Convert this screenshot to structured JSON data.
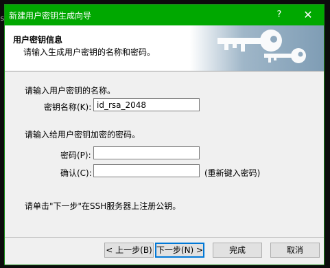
{
  "window": {
    "title": "新建用户密钥生成向导",
    "help_symbol": "?",
    "close_symbol": "✕",
    "accent": "#00a800"
  },
  "background": {
    "edge_glyph": "se"
  },
  "header": {
    "title": "用户密钥信息",
    "subtitle": "请输入生成用户密钥的名称和密码。"
  },
  "form": {
    "name_prompt": "请输入用户密钥的名称。",
    "name_label": "密钥名称(K):",
    "name_value": "id_rsa_2048",
    "password_prompt": "请输入给用户密钥加密的密码。",
    "password_label": "密码(P):",
    "password_value": "",
    "confirm_label": "确认(C):",
    "confirm_value": "",
    "confirm_hint": "(重新键入密码)",
    "footer_note": "请单击\"下一步\"在SSH服务器上注册公钥。"
  },
  "buttons": {
    "back": "< 上一步(B)",
    "next": "下一步(N) >",
    "finish": "完成",
    "cancel": "取消"
  }
}
